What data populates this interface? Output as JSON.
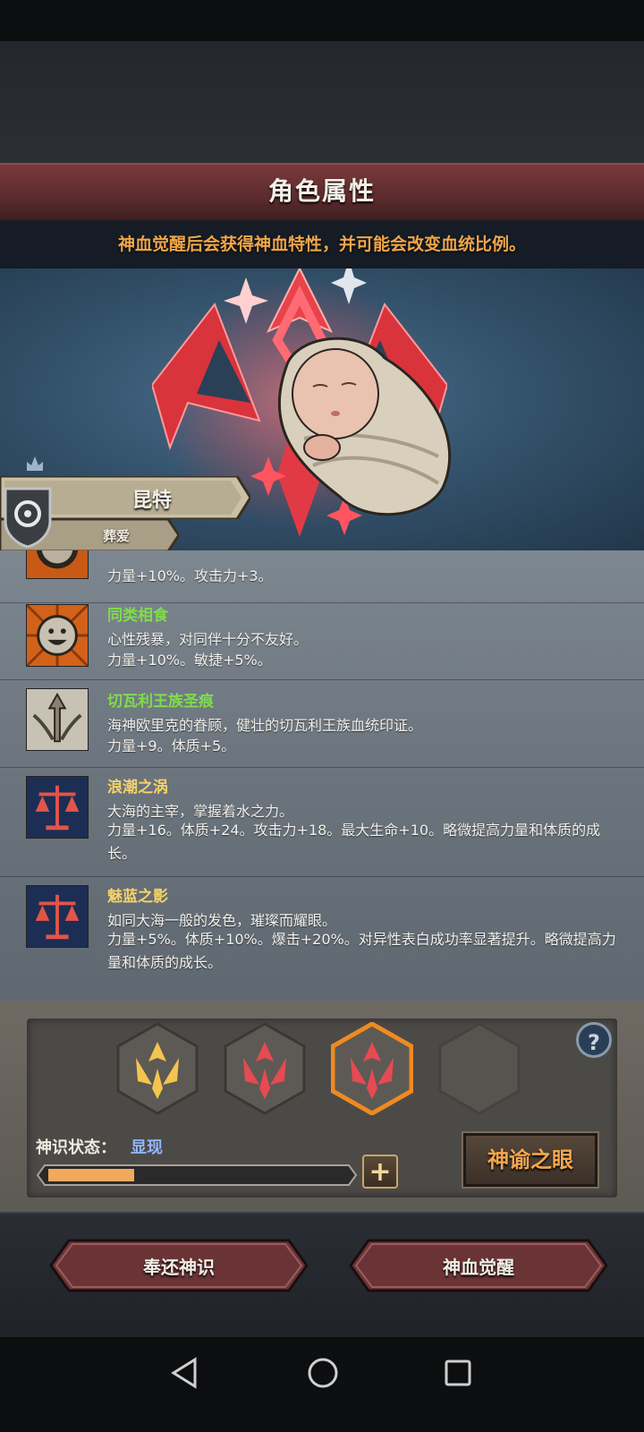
{
  "header": {
    "title": "角色属性",
    "hint": "神血觉醒后会获得神血特性，并可能会改变血统比例。"
  },
  "character": {
    "name": "昆特",
    "subtitle": "葬爱",
    "portrait_icon": "swaddled-baby-portrait",
    "crest_icon": "dragon-shield-icon"
  },
  "traits": [
    {
      "name": "",
      "description": "",
      "effects": "力量+10%。攻击力+3。",
      "name_color": "#7fdc4a",
      "icon": "face-icon"
    },
    {
      "name": "同类相食",
      "description": "心性残暴，对同伴十分不友好。",
      "effects": "力量+10%。敏捷+5%。",
      "name_color": "#7fdc4a",
      "icon": "grin-face-icon"
    },
    {
      "name": "切瓦利王族圣痕",
      "description": "海神欧里克的眷顾，健壮的切瓦利王族血统印证。",
      "effects": "力量+9。体质+5。",
      "name_color": "#7fdc4a",
      "icon": "wings-sigil-icon"
    },
    {
      "name": "浪潮之涡",
      "description": "大海的主宰，掌握着水之力。",
      "effects": "力量+16。体质+24。攻击力+18。最大生命+10。略微提高力量和体质的成长。",
      "name_color": "#f5d36a",
      "icon": "scales-icon"
    },
    {
      "name": "魅蓝之影",
      "description": "如同大海一般的发色，璀璨而耀眼。",
      "effects": "力量+5%。体质+10%。爆击+20%。对异性表白成功率显著提升。略微提高力量和体质的成长。",
      "name_color": "#f5d36a",
      "icon": "scales-icon"
    }
  ],
  "divine": {
    "slots": [
      {
        "state": "gold",
        "icon": "gold-sigil-icon"
      },
      {
        "state": "red",
        "icon": "red-sigil-icon"
      },
      {
        "state": "selected",
        "icon": "red-sigil-icon"
      },
      {
        "state": "empty",
        "icon": "empty-slot"
      }
    ],
    "status_label": "神识状态：",
    "status_value": "显现",
    "progress": 0.29,
    "plus_label": "+",
    "help_label": "?",
    "oracle_button": "神谕之眼"
  },
  "actions": {
    "return_label": "奉还神识",
    "awaken_label": "神血觉醒"
  },
  "colors": {
    "accent_orange": "#f0a64a",
    "title_red": "#6a3234",
    "status_blue": "#8fb6ff",
    "progress_fill": "#f2a95c"
  }
}
